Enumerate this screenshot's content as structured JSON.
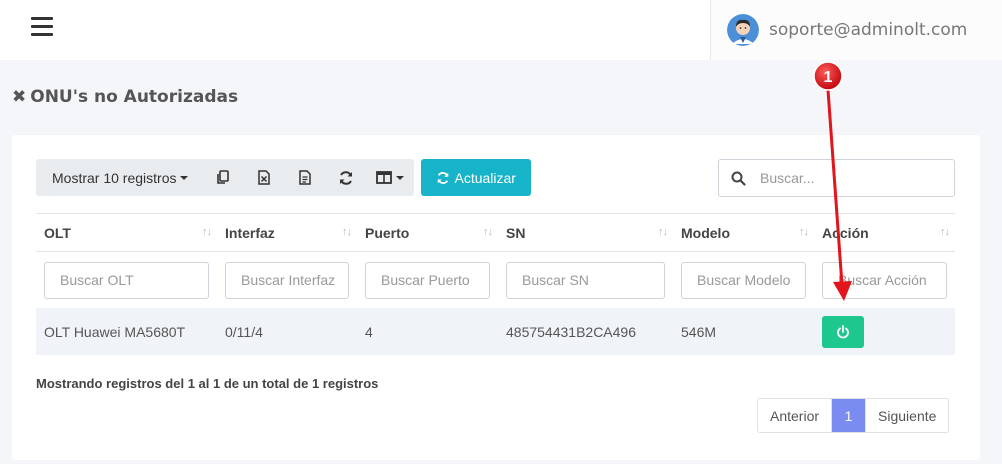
{
  "header": {
    "user_email": "soporte@adminolt.com"
  },
  "page": {
    "title": "ONU's no Autorizadas"
  },
  "toolbar": {
    "page_length_label": "Mostrar 10 registros",
    "refresh_label": "Actualizar",
    "icons": [
      "copy-icon",
      "excel-icon",
      "csv-icon",
      "reload-icon",
      "columns-icon"
    ]
  },
  "search": {
    "placeholder": "Buscar..."
  },
  "table": {
    "columns": [
      "OLT",
      "Interfaz",
      "Puerto",
      "SN",
      "Modelo",
      "Acción"
    ],
    "filters": [
      "Buscar OLT",
      "Buscar Interfaz",
      "Buscar Puerto",
      "Buscar SN",
      "Buscar Modelo",
      "Buscar Acción"
    ],
    "rows": [
      {
        "olt": "OLT Huawei MA5680T",
        "interfaz": "0/11/4",
        "puerto": "4",
        "sn": "485754431B2CA496",
        "modelo": "546M"
      }
    ]
  },
  "footer": {
    "info": "Mostrando registros del 1 al 1 de un total de 1 registros",
    "prev_label": "Anterior",
    "current_page": "1",
    "next_label": "Siguiente"
  },
  "annotation": {
    "marker_label": "1",
    "color": "#e2141c"
  },
  "colors": {
    "refresh_button": "#17b3c8",
    "action_button": "#1ec78e",
    "active_page": "#7b8cf0"
  }
}
